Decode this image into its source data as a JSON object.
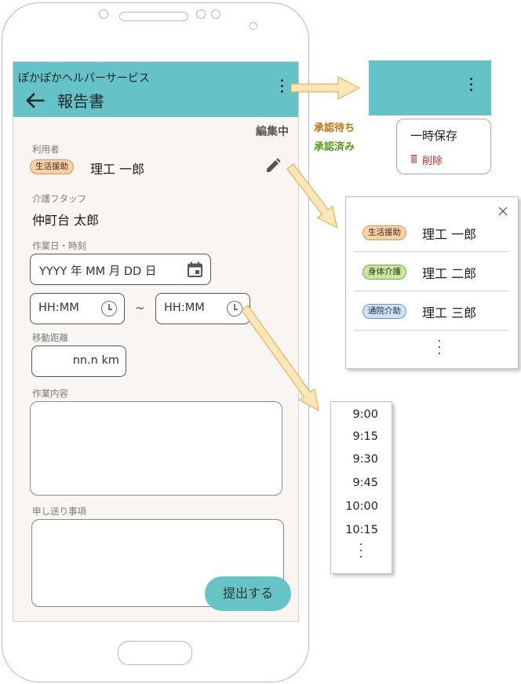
{
  "app": {
    "brand": "ぽかぽかヘルパーサービス",
    "title": "報告書",
    "edit_status": "編集中"
  },
  "form": {
    "user_label": "利用者",
    "user_badge": "生活援助",
    "user_name": "理工 一郎",
    "staff_label": "介護フタッフ",
    "staff_name": "仲町台 太郎",
    "datetime_label": "作業日・時刻",
    "date_placeholder": "YYYY 年 MM 月 DD 日",
    "time_start_placeholder": "HH:MM",
    "time_separator": "~",
    "time_end_placeholder": "HH:MM",
    "distance_label": "移動距離",
    "distance_placeholder": "nn.n km",
    "work_label": "作業内容",
    "notes_label": "申し送り事項",
    "submit_label": "提出する"
  },
  "menu_panel": {
    "status_pending": "承認待ち",
    "status_approved": "承認済み",
    "items": [
      {
        "label": "一時保存",
        "icon": "clock-icon"
      },
      {
        "label": "削除",
        "icon": "trash-icon",
        "color": "#c0302a"
      }
    ]
  },
  "user_picker": {
    "users": [
      {
        "badge": "生活援助",
        "name": "理工 一郎",
        "badge_color": "#fbd2a8"
      },
      {
        "badge": "身体介護",
        "name": "理工 二郎",
        "badge_color": "#c9e7a0"
      },
      {
        "badge": "通院介助",
        "name": "理工 三郎",
        "badge_color": "#cfe3f7"
      }
    ]
  },
  "time_picker": {
    "times": [
      "9:00",
      "9:15",
      "9:30",
      "9:45",
      "10:00",
      "10:15"
    ]
  },
  "colors": {
    "appbar": "#65c2c6",
    "screen_bg": "#f9f5f2",
    "arrow_fill": "#fde7b8",
    "arrow_stroke": "#e8b15a"
  }
}
